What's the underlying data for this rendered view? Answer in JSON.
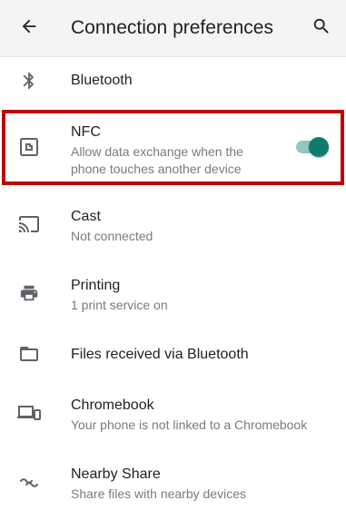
{
  "header": {
    "title": "Connection preferences",
    "back_icon": "arrow-back-icon",
    "search_icon": "search-icon"
  },
  "items": [
    {
      "icon": "bluetooth-icon",
      "title": "Bluetooth",
      "subtitle": ""
    },
    {
      "icon": "nfc-icon",
      "title": "NFC",
      "subtitle": "Allow data exchange when the phone touches another device",
      "toggle_on": true
    },
    {
      "icon": "cast-icon",
      "title": "Cast",
      "subtitle": "Not connected"
    },
    {
      "icon": "printer-icon",
      "title": "Printing",
      "subtitle": "1 print service on"
    },
    {
      "icon": "folder-icon",
      "title": "Files received via Bluetooth",
      "subtitle": ""
    },
    {
      "icon": "chromebook-icon",
      "title": "Chromebook",
      "subtitle": "Your phone is not linked to a Chromebook"
    },
    {
      "icon": "nearby-share-icon",
      "title": "Nearby Share",
      "subtitle": "Share files with nearby devices"
    }
  ],
  "colors": {
    "accent": "#0f7b6c",
    "accent_track": "#8fc9c2",
    "highlight_border": "#c00000",
    "header_bg": "#f4f4f4"
  }
}
